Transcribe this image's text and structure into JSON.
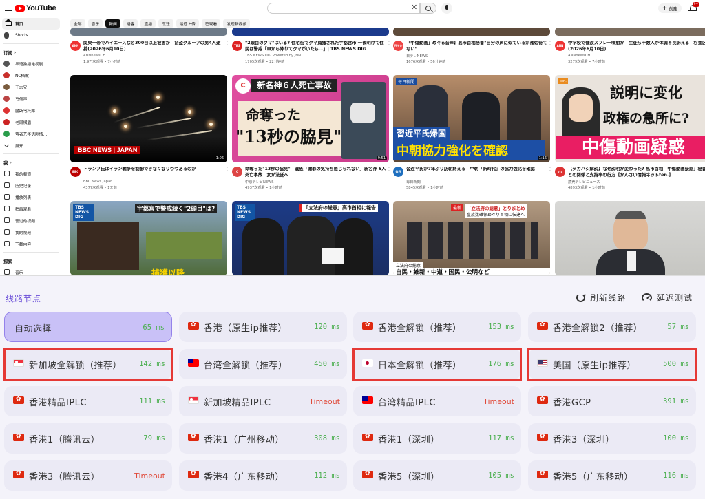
{
  "youtube": {
    "logo_text": "YouTube",
    "create_label": "创建",
    "bell_badge": "9+",
    "sidebar": {
      "main": [
        {
          "label": "首页",
          "icon": "home-icon"
        },
        {
          "label": "Shorts",
          "icon": "shorts-icon"
        }
      ],
      "subs_header": "订阅",
      "subs": [
        {
          "label": "华语独播电视剧…",
          "color": "#555"
        },
        {
          "label": "NC档案",
          "color": "#c9302c"
        },
        {
          "label": "王志安",
          "color": "#7a5c3e"
        },
        {
          "label": "马何声",
          "color": "#b44"
        },
        {
          "label": "魔斯乌托邦",
          "color": "#d33"
        },
        {
          "label": "老周横眉",
          "color": "#c22"
        },
        {
          "label": "萤者艺华语剧情…",
          "color": "#2a9d4b"
        }
      ],
      "expand_label": "展开",
      "me_header": "我",
      "me": [
        {
          "label": "我的频道"
        },
        {
          "label": "历史记录"
        },
        {
          "label": "播放列表"
        },
        {
          "label": "稍后观看"
        },
        {
          "label": "警过的视频"
        },
        {
          "label": "我的视频"
        },
        {
          "label": "下载内容"
        }
      ],
      "explore_header": "探索",
      "explore": [
        {
          "label": "音乐"
        }
      ]
    },
    "chips": [
      "全部",
      "音乐",
      "新闻",
      "播客",
      "直播",
      "烹饪",
      "最近上传",
      "已观看",
      "发现新视频"
    ],
    "active_chip_index": 2,
    "row0": [
      {
        "title": "関東一帯でハイエースなど300台以上被害か　窃盗グループの男4人逮捕(2026年6月10日)",
        "channel": "ANNnewsCH",
        "stats": "1.9万次观看 • 7小时前",
        "avatar_color": "#e33",
        "avatar_text": "ANN"
      },
      {
        "title": "\"2頭目のクマ\"はいる? 住宅街でクマ捕獲された宇都宮市 一夜明けて住民は警戒「車から降りてクマがいたら…」| TBS NEWS DIG",
        "channel": "TBS NEWS DIG Powered by JNN",
        "stats": "1705次观看 • 22分钟前",
        "avatar_color": "#d22",
        "avatar_text": "TBS"
      },
      {
        "title": "「中傷動画」めぐる音声】高市首相秘書\"自分の声に似ているが補佐待てない\"",
        "channel": "日テレNEWS",
        "stats": "1676次观看 • 56分钟前",
        "avatar_color": "#e44",
        "avatar_text": "日テレ"
      },
      {
        "title": "中学校で催涙スプレー噴射か　生徒ら十数人が体調不良訴える　杉並区(2026年6月10日)",
        "channel": "ANNnewsCH",
        "stats": "3279次观看 • 7小时前",
        "avatar_color": "#e33",
        "avatar_text": "ANN"
      }
    ],
    "row1": [
      {
        "title": "トランプ氏はイラン戦争を制御できなくなりつつあるのか",
        "channel": "BBC News Japan",
        "stats": "4377次观看 • 1天前",
        "avatar_color": "#b00",
        "avatar_text": "BBC",
        "duration": "1:06"
      },
      {
        "title": "命奪った\"13秒の脇見\"　遺族「謝罪の気持ち感じられない」新名神 6人死亡事故　女が法廷へ",
        "channel": "中京テレビNEWS",
        "stats": "4937次观看 • 1小时前",
        "avatar_color": "#d44",
        "avatar_text": "C",
        "duration": "9:51"
      },
      {
        "title": "習近平氏が7年ぶり訪朝終える　中朝「新時代」の協力強化を確認",
        "channel": "毎日新聞",
        "stats": "5845次观看 • 1小时前",
        "avatar_color": "#1e6fbf",
        "avatar_text": "毎日",
        "duration": "1:16"
      },
      {
        "title": "【タカハシ解説】なぜ説明が変わった? 高市首相「中傷動画疑惑」秘書との関係と支持率の行方【かんさい情報ネットten.】",
        "channel": "読売テレビニュース",
        "stats": "4893次观看 • 1小时前",
        "avatar_color": "#d33",
        "avatar_text": "ytv",
        "duration": ""
      }
    ],
    "thumbs": {
      "t1_banner": "BBC NEWS | JAPAN",
      "t2_top": "新名神６人死亡事故",
      "t2_main": "命奪った",
      "t2_main2": "\"13秒の脇見\"",
      "t3_brand": "毎日新聞",
      "t3_l1": "習近平氏帰国",
      "t3_l2": "中朝協力強化を確認",
      "t4_l1": "説明に変化",
      "t4_l2": "政権の急所に?",
      "t4_l3": "中傷動画疑惑",
      "t5_tag": "TBS NEWS DIG",
      "t5_top": "宇都宮で警戒続く\"2頭目\"は?",
      "t5_bottom": "捕獲以降",
      "t6_top": "「立法府の総意」高市首相に報告",
      "t7_top": "「立法府の総意」とりまとめ",
      "t7_sub": "皇族数確保めぐり首相に伝達へ",
      "t7_bottom": "立法府の総意",
      "t7_bottom2": "自民・維新・中道・国民・公明など"
    }
  },
  "proxy_panel": {
    "title": "线路节点",
    "refresh_label": "刷新线路",
    "latency_label": "延迟测试",
    "nodes": [
      {
        "name": "自动选择",
        "latency": "65 ms",
        "flag": "",
        "selected": true,
        "timeout": false
      },
      {
        "name": "香港（原生ip推荐）",
        "latency": "120 ms",
        "flag": "hk",
        "selected": false,
        "timeout": false
      },
      {
        "name": "香港全解锁（推荐）",
        "latency": "153 ms",
        "flag": "hk",
        "selected": false,
        "timeout": false
      },
      {
        "name": "香港全解锁2（推荐）",
        "latency": "57 ms",
        "flag": "hk",
        "selected": false,
        "timeout": false
      },
      {
        "name": "新加坡全解锁（推荐）",
        "latency": "142 ms",
        "flag": "sg",
        "selected": false,
        "timeout": false,
        "highlighted": true
      },
      {
        "name": "台湾全解锁（推荐）",
        "latency": "450 ms",
        "flag": "tw",
        "selected": false,
        "timeout": false
      },
      {
        "name": "日本全解锁（推荐）",
        "latency": "176 ms",
        "flag": "jp",
        "selected": false,
        "timeout": false,
        "highlighted": true
      },
      {
        "name": "美国（原生ip推荐）",
        "latency": "500 ms",
        "flag": "us",
        "selected": false,
        "timeout": false,
        "highlighted": true
      },
      {
        "name": "香港精品IPLC",
        "latency": "111 ms",
        "flag": "hk",
        "selected": false,
        "timeout": false
      },
      {
        "name": "新加坡精品IPLC",
        "latency": "Timeout",
        "flag": "sg",
        "selected": false,
        "timeout": true
      },
      {
        "name": "台湾精品IPLC",
        "latency": "Timeout",
        "flag": "tw",
        "selected": false,
        "timeout": true
      },
      {
        "name": "香港GCP",
        "latency": "391 ms",
        "flag": "hk",
        "selected": false,
        "timeout": false
      },
      {
        "name": "香港1（腾讯云）",
        "latency": "79 ms",
        "flag": "hk",
        "selected": false,
        "timeout": false
      },
      {
        "name": "香港1（广州移动）",
        "latency": "308 ms",
        "flag": "hk",
        "selected": false,
        "timeout": false
      },
      {
        "name": "香港1（深圳）",
        "latency": "117 ms",
        "flag": "hk",
        "selected": false,
        "timeout": false
      },
      {
        "name": "香港3（深圳）",
        "latency": "100 ms",
        "flag": "hk",
        "selected": false,
        "timeout": false
      },
      {
        "name": "香港3（腾讯云）",
        "latency": "Timeout",
        "flag": "hk",
        "selected": false,
        "timeout": true
      },
      {
        "name": "香港4（广东移动）",
        "latency": "112 ms",
        "flag": "hk",
        "selected": false,
        "timeout": false
      },
      {
        "name": "香港5（深圳）",
        "latency": "105 ms",
        "flag": "hk",
        "selected": false,
        "timeout": false
      },
      {
        "name": "香港5（广东移动）",
        "latency": "116 ms",
        "flag": "hk",
        "selected": false,
        "timeout": false
      }
    ]
  }
}
